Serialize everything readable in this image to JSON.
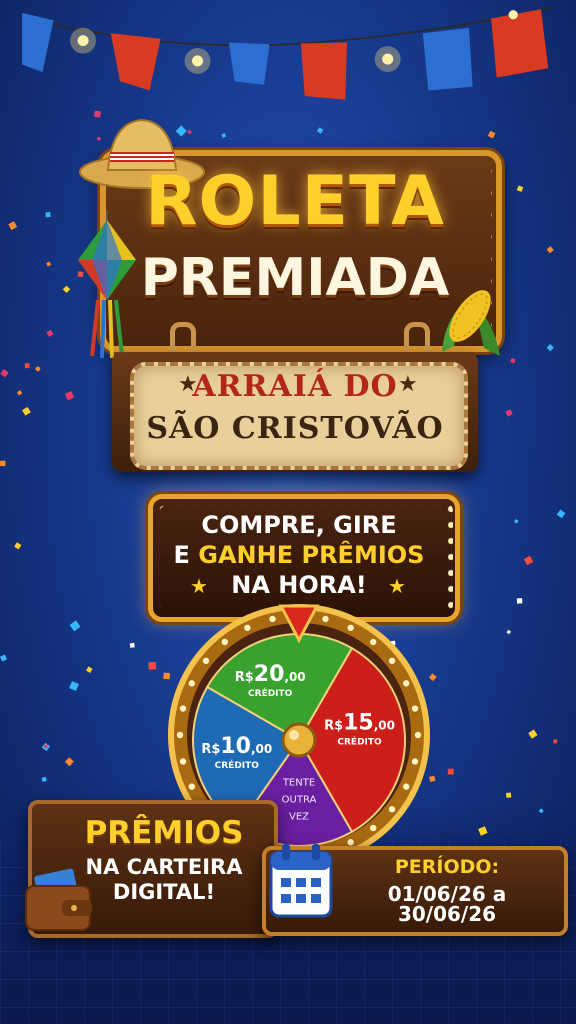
{
  "title": {
    "line1": "ROLETA",
    "line2": "PREMIADA"
  },
  "event_sign": {
    "line1": "ARRAIÁ DO",
    "line2": "SÃO CRISTOVÃO"
  },
  "promo": {
    "line1": "COMPRE, GIRE",
    "line2_prefix": "E ",
    "line2_highlight": "GANHE PRÊMIOS",
    "line3": "NA HORA!"
  },
  "wheel": {
    "segments": [
      {
        "currency": "R$",
        "amount": "20",
        "cents": ",00",
        "label": "CRÉDITO",
        "color": "#3aa12f"
      },
      {
        "currency": "R$",
        "amount": "15",
        "cents": ",00",
        "label": "CRÉDITO",
        "color": "#cc1f1a"
      },
      {
        "text": [
          "TENTE",
          "OUTRA",
          "VEZ"
        ],
        "color": "#6a1fa0"
      },
      {
        "currency": "R$",
        "amount": "10",
        "cents": ",00",
        "label": "CRÉDITO",
        "color": "#1f6ab5"
      }
    ]
  },
  "wallet_box": {
    "line1": "PRÊMIOS",
    "line2": "NA CARTEIRA",
    "line3": "DIGITAL!"
  },
  "period": {
    "label": "PERÍODO:",
    "value": "01/06/26 a 30/06/26"
  },
  "colors": {
    "accent": "#ffd02b",
    "background": "#173a8e",
    "wood": "#4a240c"
  }
}
